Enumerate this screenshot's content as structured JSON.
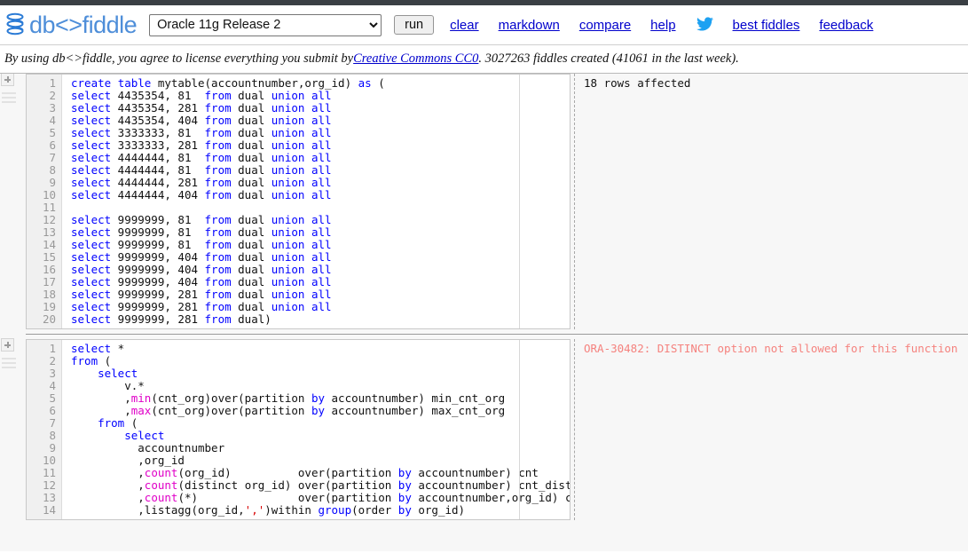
{
  "header": {
    "logo_text": "db<>fiddle",
    "logo_icon": "database-stack-icon",
    "db_select_value": "Oracle 11g Release 2",
    "db_select_options": [
      "Oracle 11g Release 2"
    ],
    "run_label": "run",
    "links": [
      {
        "label": "clear",
        "name": "clear-link"
      },
      {
        "label": "markdown",
        "name": "markdown-link"
      },
      {
        "label": "compare",
        "name": "compare-link"
      },
      {
        "label": "help",
        "name": "help-link"
      }
    ],
    "twitter_icon": "twitter-bird-icon",
    "links_right": [
      {
        "label": "best fiddles",
        "name": "best-fiddles-link"
      },
      {
        "label": "feedback",
        "name": "feedback-link"
      }
    ]
  },
  "notice": {
    "prefix": "By using db<>fiddle, you agree to license everything you submit by ",
    "link_label": "Creative Commons CC0",
    "suffix": ". 3027263 fiddles created (41061 in the last week)."
  },
  "panels": [
    {
      "name": "schema-panel",
      "add_button": "+",
      "drag_handle": "drag-handle-icon",
      "result_text": "18 rows affected",
      "result_is_error": false,
      "lines": [
        {
          "n": 1,
          "tokens": [
            {
              "t": "create",
              "c": "kw"
            },
            {
              "t": " "
            },
            {
              "t": "table",
              "c": "kw"
            },
            {
              "t": " mytable(accountnumber,org_id) "
            },
            {
              "t": "as",
              "c": "kw"
            },
            {
              "t": " ("
            }
          ]
        },
        {
          "n": 2,
          "tokens": [
            {
              "t": "select",
              "c": "kw"
            },
            {
              "t": " 4435354, 81  "
            },
            {
              "t": "from",
              "c": "kw"
            },
            {
              "t": " dual "
            },
            {
              "t": "union",
              "c": "kw"
            },
            {
              "t": " "
            },
            {
              "t": "all",
              "c": "kw"
            }
          ]
        },
        {
          "n": 3,
          "tokens": [
            {
              "t": "select",
              "c": "kw"
            },
            {
              "t": " 4435354, 281 "
            },
            {
              "t": "from",
              "c": "kw"
            },
            {
              "t": " dual "
            },
            {
              "t": "union",
              "c": "kw"
            },
            {
              "t": " "
            },
            {
              "t": "all",
              "c": "kw"
            }
          ]
        },
        {
          "n": 4,
          "tokens": [
            {
              "t": "select",
              "c": "kw"
            },
            {
              "t": " 4435354, 404 "
            },
            {
              "t": "from",
              "c": "kw"
            },
            {
              "t": " dual "
            },
            {
              "t": "union",
              "c": "kw"
            },
            {
              "t": " "
            },
            {
              "t": "all",
              "c": "kw"
            }
          ]
        },
        {
          "n": 5,
          "tokens": [
            {
              "t": "select",
              "c": "kw"
            },
            {
              "t": " 3333333, 81  "
            },
            {
              "t": "from",
              "c": "kw"
            },
            {
              "t": " dual "
            },
            {
              "t": "union",
              "c": "kw"
            },
            {
              "t": " "
            },
            {
              "t": "all",
              "c": "kw"
            }
          ]
        },
        {
          "n": 6,
          "tokens": [
            {
              "t": "select",
              "c": "kw"
            },
            {
              "t": " 3333333, 281 "
            },
            {
              "t": "from",
              "c": "kw"
            },
            {
              "t": " dual "
            },
            {
              "t": "union",
              "c": "kw"
            },
            {
              "t": " "
            },
            {
              "t": "all",
              "c": "kw"
            }
          ]
        },
        {
          "n": 7,
          "tokens": [
            {
              "t": "select",
              "c": "kw"
            },
            {
              "t": " 4444444, 81  "
            },
            {
              "t": "from",
              "c": "kw"
            },
            {
              "t": " dual "
            },
            {
              "t": "union",
              "c": "kw"
            },
            {
              "t": " "
            },
            {
              "t": "all",
              "c": "kw"
            }
          ]
        },
        {
          "n": 8,
          "tokens": [
            {
              "t": "select",
              "c": "kw"
            },
            {
              "t": " 4444444, 81  "
            },
            {
              "t": "from",
              "c": "kw"
            },
            {
              "t": " dual "
            },
            {
              "t": "union",
              "c": "kw"
            },
            {
              "t": " "
            },
            {
              "t": "all",
              "c": "kw"
            }
          ]
        },
        {
          "n": 9,
          "tokens": [
            {
              "t": "select",
              "c": "kw"
            },
            {
              "t": " 4444444, 281 "
            },
            {
              "t": "from",
              "c": "kw"
            },
            {
              "t": " dual "
            },
            {
              "t": "union",
              "c": "kw"
            },
            {
              "t": " "
            },
            {
              "t": "all",
              "c": "kw"
            }
          ]
        },
        {
          "n": 10,
          "tokens": [
            {
              "t": "select",
              "c": "kw"
            },
            {
              "t": " 4444444, 404 "
            },
            {
              "t": "from",
              "c": "kw"
            },
            {
              "t": " dual "
            },
            {
              "t": "union",
              "c": "kw"
            },
            {
              "t": " "
            },
            {
              "t": "all",
              "c": "kw"
            }
          ]
        },
        {
          "n": 11,
          "tokens": [
            {
              "t": ""
            }
          ]
        },
        {
          "n": 12,
          "tokens": [
            {
              "t": "select",
              "c": "kw"
            },
            {
              "t": " 9999999, 81  "
            },
            {
              "t": "from",
              "c": "kw"
            },
            {
              "t": " dual "
            },
            {
              "t": "union",
              "c": "kw"
            },
            {
              "t": " "
            },
            {
              "t": "all",
              "c": "kw"
            }
          ]
        },
        {
          "n": 13,
          "tokens": [
            {
              "t": "select",
              "c": "kw"
            },
            {
              "t": " 9999999, 81  "
            },
            {
              "t": "from",
              "c": "kw"
            },
            {
              "t": " dual "
            },
            {
              "t": "union",
              "c": "kw"
            },
            {
              "t": " "
            },
            {
              "t": "all",
              "c": "kw"
            }
          ]
        },
        {
          "n": 14,
          "tokens": [
            {
              "t": "select",
              "c": "kw"
            },
            {
              "t": " 9999999, 81  "
            },
            {
              "t": "from",
              "c": "kw"
            },
            {
              "t": " dual "
            },
            {
              "t": "union",
              "c": "kw"
            },
            {
              "t": " "
            },
            {
              "t": "all",
              "c": "kw"
            }
          ]
        },
        {
          "n": 15,
          "tokens": [
            {
              "t": "select",
              "c": "kw"
            },
            {
              "t": " 9999999, 404 "
            },
            {
              "t": "from",
              "c": "kw"
            },
            {
              "t": " dual "
            },
            {
              "t": "union",
              "c": "kw"
            },
            {
              "t": " "
            },
            {
              "t": "all",
              "c": "kw"
            }
          ]
        },
        {
          "n": 16,
          "tokens": [
            {
              "t": "select",
              "c": "kw"
            },
            {
              "t": " 9999999, 404 "
            },
            {
              "t": "from",
              "c": "kw"
            },
            {
              "t": " dual "
            },
            {
              "t": "union",
              "c": "kw"
            },
            {
              "t": " "
            },
            {
              "t": "all",
              "c": "kw"
            }
          ]
        },
        {
          "n": 17,
          "tokens": [
            {
              "t": "select",
              "c": "kw"
            },
            {
              "t": " 9999999, 404 "
            },
            {
              "t": "from",
              "c": "kw"
            },
            {
              "t": " dual "
            },
            {
              "t": "union",
              "c": "kw"
            },
            {
              "t": " "
            },
            {
              "t": "all",
              "c": "kw"
            }
          ]
        },
        {
          "n": 18,
          "tokens": [
            {
              "t": "select",
              "c": "kw"
            },
            {
              "t": " 9999999, 281 "
            },
            {
              "t": "from",
              "c": "kw"
            },
            {
              "t": " dual "
            },
            {
              "t": "union",
              "c": "kw"
            },
            {
              "t": " "
            },
            {
              "t": "all",
              "c": "kw"
            }
          ]
        },
        {
          "n": 19,
          "tokens": [
            {
              "t": "select",
              "c": "kw"
            },
            {
              "t": " 9999999, 281 "
            },
            {
              "t": "from",
              "c": "kw"
            },
            {
              "t": " dual "
            },
            {
              "t": "union",
              "c": "kw"
            },
            {
              "t": " "
            },
            {
              "t": "all",
              "c": "kw"
            }
          ]
        },
        {
          "n": 20,
          "tokens": [
            {
              "t": "select",
              "c": "kw"
            },
            {
              "t": " 9999999, 281 "
            },
            {
              "t": "from",
              "c": "kw"
            },
            {
              "t": " dual)"
            }
          ]
        }
      ]
    },
    {
      "name": "query-panel",
      "add_button": "+",
      "drag_handle": "drag-handle-icon",
      "result_text": "ORA-30482: DISTINCT option not allowed for this function",
      "result_is_error": true,
      "lines": [
        {
          "n": 1,
          "tokens": [
            {
              "t": "select",
              "c": "kw"
            },
            {
              "t": " *"
            }
          ]
        },
        {
          "n": 2,
          "tokens": [
            {
              "t": "from",
              "c": "kw"
            },
            {
              "t": " ("
            }
          ]
        },
        {
          "n": 3,
          "tokens": [
            {
              "t": "    "
            },
            {
              "t": "select",
              "c": "kw"
            }
          ]
        },
        {
          "n": 4,
          "tokens": [
            {
              "t": "        v.*"
            }
          ]
        },
        {
          "n": 5,
          "tokens": [
            {
              "t": "        ,"
            },
            {
              "t": "min",
              "c": "fn"
            },
            {
              "t": "(cnt_org)over(partition "
            },
            {
              "t": "by",
              "c": "kw"
            },
            {
              "t": " accountnumber) min_cnt_org"
            }
          ]
        },
        {
          "n": 6,
          "tokens": [
            {
              "t": "        ,"
            },
            {
              "t": "max",
              "c": "fn"
            },
            {
              "t": "(cnt_org)over(partition "
            },
            {
              "t": "by",
              "c": "kw"
            },
            {
              "t": " accountnumber) max_cnt_org"
            }
          ]
        },
        {
          "n": 7,
          "tokens": [
            {
              "t": "    "
            },
            {
              "t": "from",
              "c": "kw"
            },
            {
              "t": " ("
            }
          ]
        },
        {
          "n": 8,
          "tokens": [
            {
              "t": "        "
            },
            {
              "t": "select",
              "c": "kw"
            }
          ]
        },
        {
          "n": 9,
          "tokens": [
            {
              "t": "          accountnumber"
            }
          ]
        },
        {
          "n": 10,
          "tokens": [
            {
              "t": "          ,org_id"
            }
          ]
        },
        {
          "n": 11,
          "tokens": [
            {
              "t": "          ,"
            },
            {
              "t": "count",
              "c": "fn"
            },
            {
              "t": "(org_id)          over(partition "
            },
            {
              "t": "by",
              "c": "kw"
            },
            {
              "t": " accountnumber) cnt"
            }
          ]
        },
        {
          "n": 12,
          "tokens": [
            {
              "t": "          ,"
            },
            {
              "t": "count",
              "c": "fn"
            },
            {
              "t": "(distinct org_id) over(partition "
            },
            {
              "t": "by",
              "c": "kw"
            },
            {
              "t": " accountnumber) cnt_distinct"
            }
          ]
        },
        {
          "n": 13,
          "tokens": [
            {
              "t": "          ,"
            },
            {
              "t": "count",
              "c": "fn"
            },
            {
              "t": "(*)               over(partition "
            },
            {
              "t": "by",
              "c": "kw"
            },
            {
              "t": " accountnumber,org_id) cnt_org"
            }
          ]
        },
        {
          "n": 14,
          "tokens": [
            {
              "t": "          ,listagg(org_id,"
            },
            {
              "t": "','",
              "c": "str"
            },
            {
              "t": ")within "
            },
            {
              "t": "group",
              "c": "kw"
            },
            {
              "t": "(order "
            },
            {
              "t": "by",
              "c": "kw"
            },
            {
              "t": " org_id)"
            }
          ]
        }
      ]
    }
  ]
}
